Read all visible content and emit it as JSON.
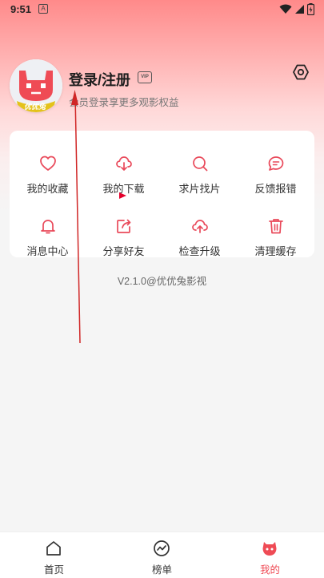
{
  "status_bar": {
    "time": "9:51",
    "notice_letter": "A"
  },
  "profile": {
    "avatar_caption": "优优兔",
    "login_label": "登录/注册",
    "vip_badge": "VIP",
    "subtitle": "会员登录享更多观影权益"
  },
  "menu": {
    "items": [
      {
        "label": "我的收藏",
        "icon": "heart-icon"
      },
      {
        "label": "我的下载",
        "icon": "cloud-download-icon"
      },
      {
        "label": "求片找片",
        "icon": "search-icon"
      },
      {
        "label": "反馈报错",
        "icon": "chat-icon"
      },
      {
        "label": "消息中心",
        "icon": "bell-icon"
      },
      {
        "label": "分享好友",
        "icon": "share-icon"
      },
      {
        "label": "检查升级",
        "icon": "cloud-upload-icon"
      },
      {
        "label": "清理缓存",
        "icon": "trash-icon"
      }
    ]
  },
  "version_text": "V2.1.0@优优兔影视",
  "bottom_nav": {
    "items": [
      {
        "label": "首页",
        "icon": "home-icon"
      },
      {
        "label": "榜单",
        "icon": "trend-icon"
      },
      {
        "label": "我的",
        "icon": "mascot-icon",
        "active": true
      }
    ]
  },
  "colors": {
    "accent": "#ef4b55",
    "icon_red": "#e9495a",
    "text": "#333333"
  }
}
